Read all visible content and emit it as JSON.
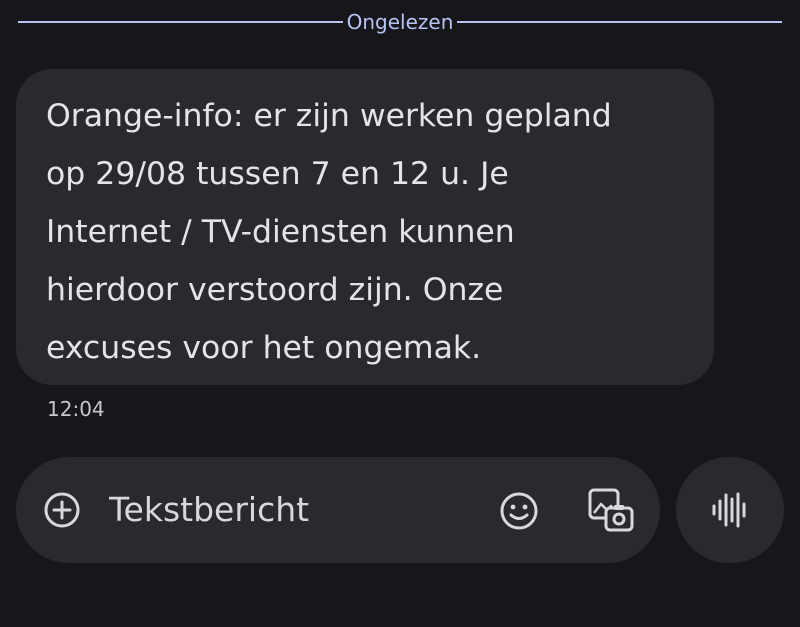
{
  "divider": {
    "label": "Ongelezen"
  },
  "message": {
    "text": "Orange-info: er zijn werken gepland\nop 29/08 tussen 7 en 12 u. Je\nInternet / TV-diensten kunnen\nhierdoor verstoord zijn. Onze\nexcuses voor het ongemak.",
    "timestamp": "12:04"
  },
  "compose": {
    "placeholder": "Tekstbericht",
    "icons": {
      "add": "add-circle-icon",
      "emoji": "emoji-icon",
      "media": "gallery-icon",
      "voice": "voice-waveform-icon"
    }
  },
  "colors": {
    "background": "#16161b",
    "bubble": "#2a2a2e",
    "text": "#e6e3e8",
    "divider_accent": "#b7c3f2"
  }
}
